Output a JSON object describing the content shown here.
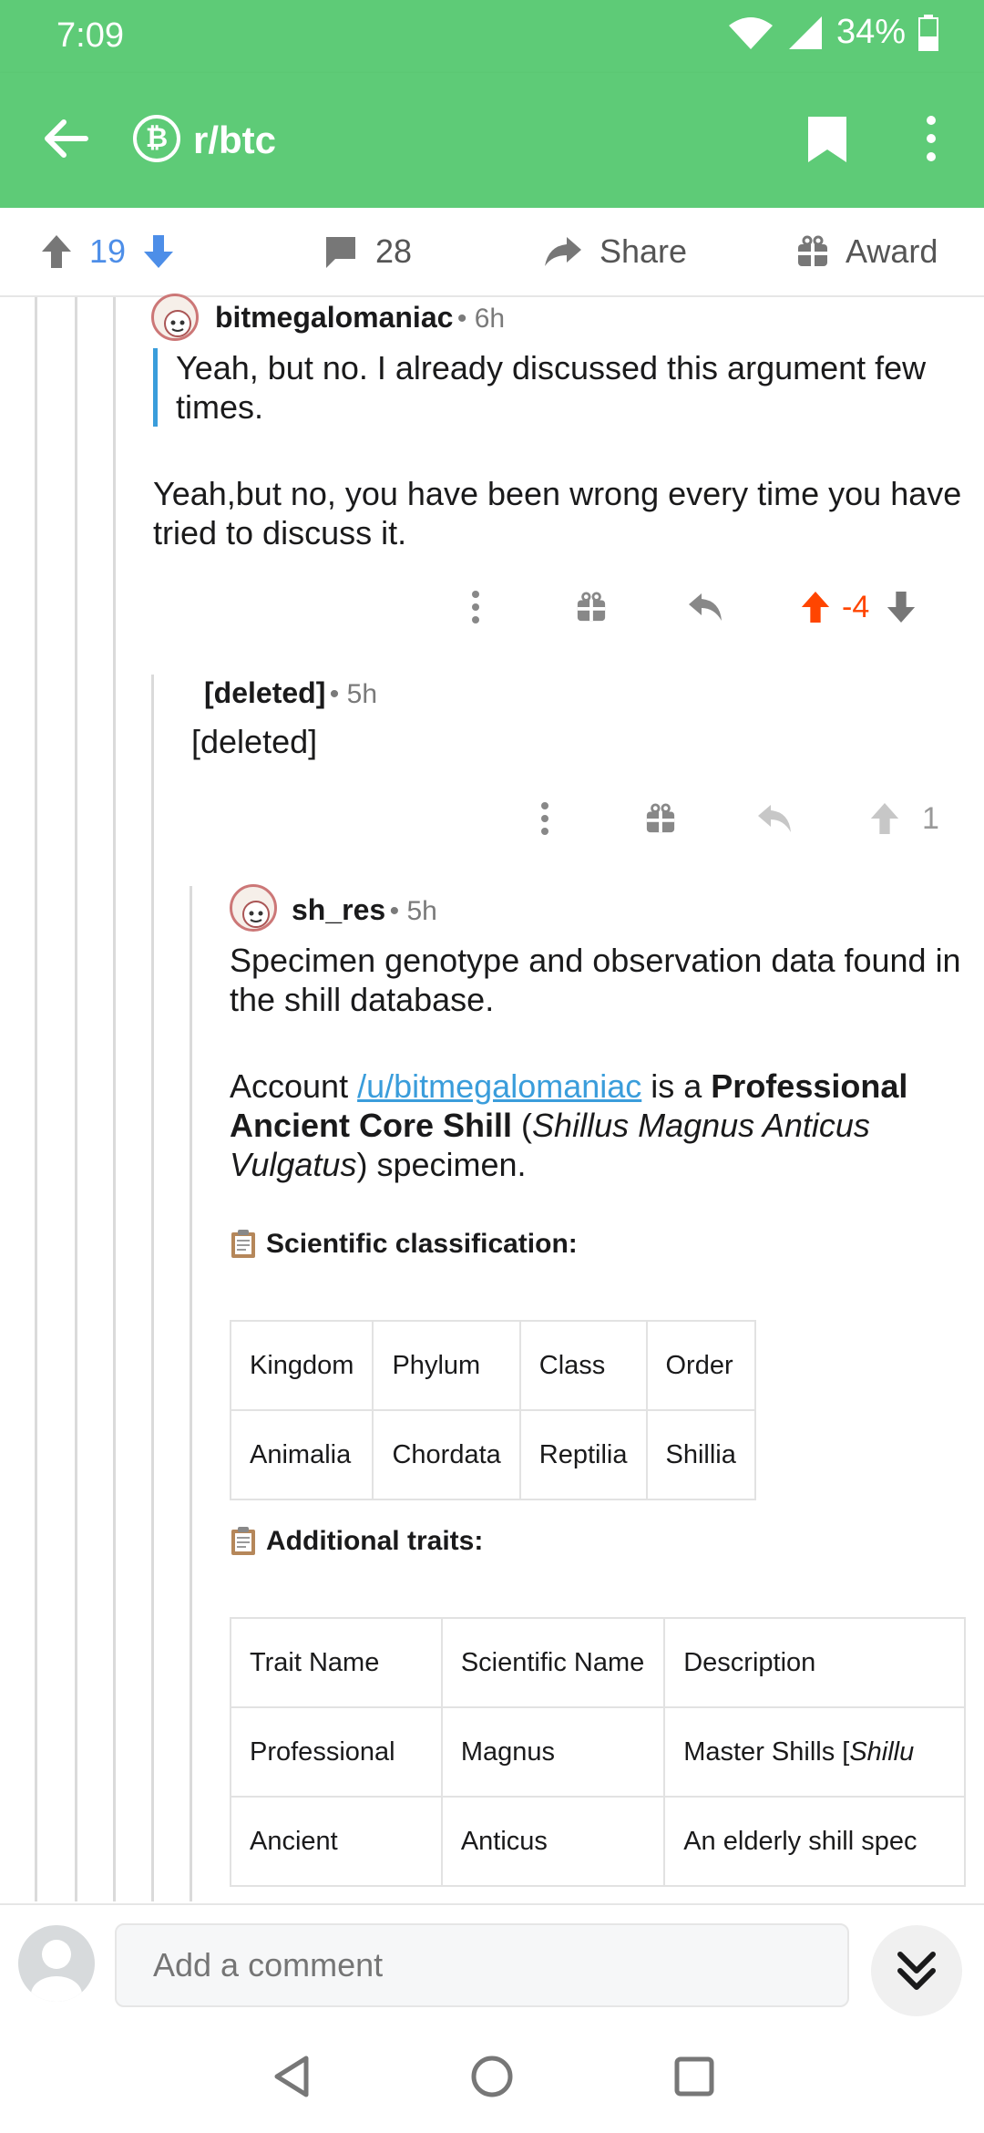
{
  "status": {
    "time": "7:09",
    "battery": "34%"
  },
  "appbar": {
    "subreddit": "r/btc",
    "sub_icon": "₿"
  },
  "actions": {
    "score": "19",
    "comments": "28",
    "share": "Share",
    "award": "Award"
  },
  "comment1": {
    "author": "bitmegalomaniac",
    "age": "• 6h",
    "quote": "Yeah, but no. I already discussed this argument few times.",
    "text": "Yeah,but no, you have been wrong every time you have tried to discuss it.",
    "score": "-4"
  },
  "comment2": {
    "author": "[deleted]",
    "age": "• 5h",
    "text": "[deleted]",
    "score": "1"
  },
  "comment3": {
    "author": "sh_res",
    "age": "• 5h",
    "intro": "Specimen genotype and observation data found in the shill database.",
    "account_prefix": "Account ",
    "account_link": "/u/bitmegalomaniac",
    "account_mid": " is a ",
    "account_bold": "Professional Ancient Core Shill",
    "paren_open": " (",
    "account_italic": "Shillus Magnus Anticus Vulgatus",
    "account_suffix": ") specimen.",
    "classification_heading": "Scientific classification:",
    "classification_table": {
      "headers": [
        "Kingdom",
        "Phylum",
        "Class",
        "Order"
      ],
      "row": [
        "Animalia",
        "Chordata",
        "Reptilia",
        "Shillia"
      ]
    },
    "traits_heading": "Additional traits:",
    "traits_table": {
      "headers": [
        "Trait Name",
        "Scientific Name",
        "Description"
      ],
      "rows": [
        [
          "Professional",
          "Magnus",
          "Master Shills [",
          "Shillu"
        ],
        [
          "Ancient",
          "Anticus",
          "An elderly shill spec",
          ""
        ]
      ]
    }
  },
  "comment_bar": {
    "placeholder": "Add a comment"
  },
  "colors": {
    "brand_green": "#5ecb77",
    "upvote_blue": "#4d8ee8",
    "downvote_red": "#ff4500",
    "link_blue": "#3a9ddb"
  }
}
